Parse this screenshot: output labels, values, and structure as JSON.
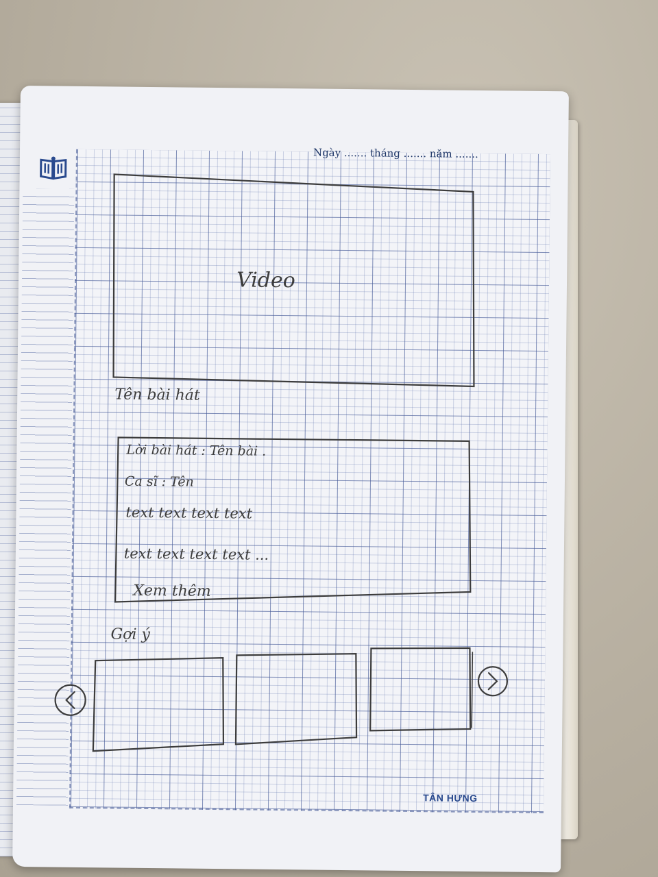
{
  "notebook": {
    "date_line": "Ngày ....... tháng ....... năm .......",
    "brand": "TÂN HƯNG"
  },
  "sketch": {
    "video_label": "Video",
    "title_label": "Tên bài hát",
    "info_box": {
      "lyrics_line": "Lời bài hát : Tên bài .",
      "singer_line": "Ca sĩ : Tên",
      "text_line_1": "text text text text",
      "text_line_2": "text text text text ...",
      "see_more": "Xem thêm"
    },
    "suggestions_label": "Gợi ý",
    "prev_icon": "chevron-left-circle",
    "next_icon": "chevron-right-circle",
    "suggestion_cards": 3
  },
  "colors": {
    "ink": "#3c3c3c",
    "grid": "#465a96",
    "print": "#1f3768"
  }
}
